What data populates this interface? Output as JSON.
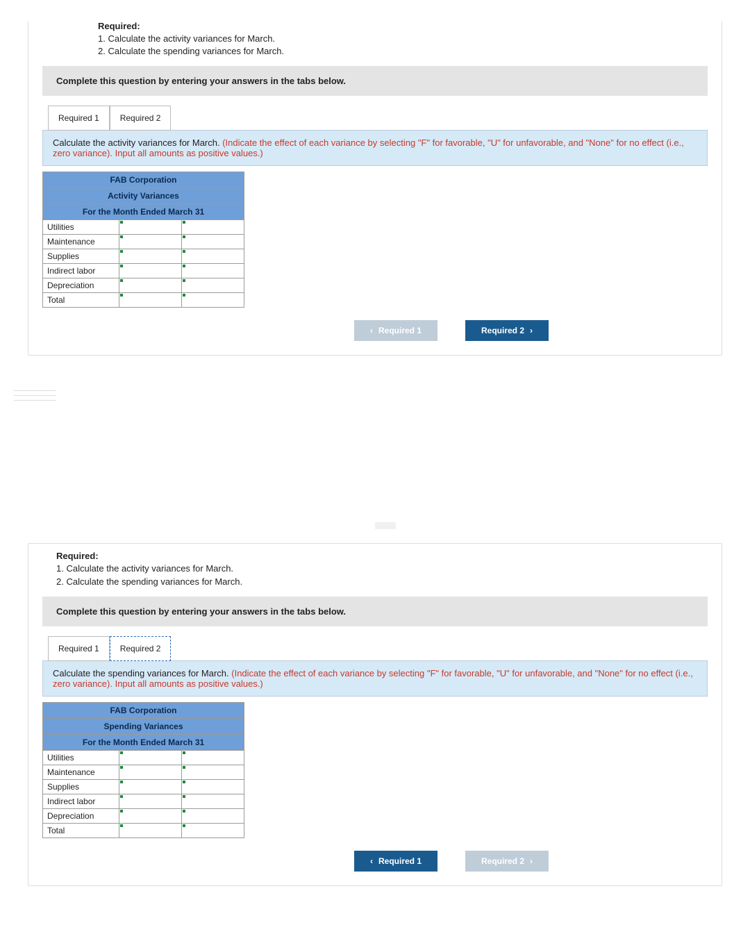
{
  "required": {
    "heading": "Required:",
    "item1": "1. Calculate the activity variances for March.",
    "item2": "2. Calculate the spending variances for March."
  },
  "instruction": "Complete this question by entering your answers in the tabs below.",
  "tabs": {
    "tab1": "Required 1",
    "tab2": "Required 2"
  },
  "panel1": {
    "prompt_black": "Calculate the activity variances for March. ",
    "prompt_red": "(Indicate the effect of each variance by selecting \"F\" for favorable, \"U\" for unfavorable, and \"None\" for no effect (i.e., zero variance). Input all amounts as positive values.)",
    "header1": "FAB Corporation",
    "header2": "Activity Variances",
    "header3": "For the Month Ended March 31",
    "rows": [
      "Utilities",
      "Maintenance",
      "Supplies",
      "Indirect labor",
      "Depreciation",
      "Total"
    ],
    "nav_prev": "Required 1",
    "nav_next": "Required 2"
  },
  "panel2": {
    "prompt_black": "Calculate the spending variances for March. ",
    "prompt_red": "(Indicate the effect of each variance by selecting \"F\" for favorable, \"U\" for unfavorable, and \"None\" for no effect (i.e., zero variance). Input all amounts as positive values.)",
    "header1": "FAB Corporation",
    "header2": "Spending Variances",
    "header3": "For the Month Ended March 31",
    "rows": [
      "Utilities",
      "Maintenance",
      "Supplies",
      "Indirect labor",
      "Depreciation",
      "Total"
    ],
    "nav_prev": "Required 1",
    "nav_next": "Required 2"
  }
}
